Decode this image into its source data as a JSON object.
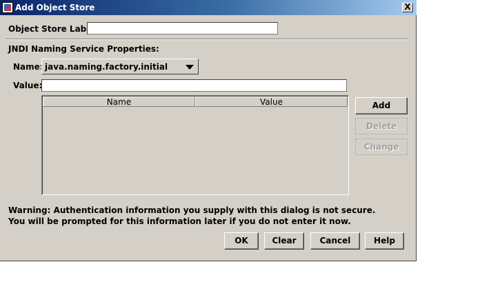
{
  "window": {
    "title": "Add Object Store",
    "close_glyph": "X"
  },
  "object_store": {
    "label": "Object Store Label:",
    "value": ""
  },
  "jndi": {
    "section_title": "JNDI Naming Service Properties:",
    "name_label": "Name:",
    "name_selected": "java.naming.factory.initial",
    "value_label": "Value:",
    "value_value": ""
  },
  "table": {
    "columns": [
      "Name",
      "Value"
    ],
    "rows": []
  },
  "side_buttons": {
    "add": "Add",
    "delete": "Delete",
    "change": "Change"
  },
  "warning": "Warning: Authentication information you supply with this dialog is not secure. You will be prompted for this information later if you do not enter it now.",
  "footer_buttons": {
    "ok": "OK",
    "clear": "Clear",
    "cancel": "Cancel",
    "help": "Help"
  },
  "icons": {
    "app": "java-app-icon",
    "close": "close-icon",
    "dropdown": "chevron-down-icon"
  }
}
